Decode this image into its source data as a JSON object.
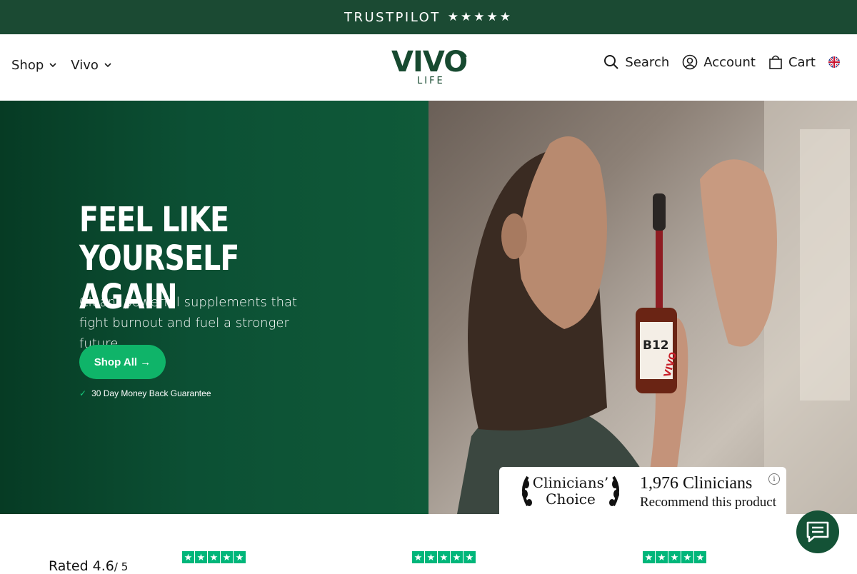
{
  "topbar": {
    "brand": "TRUSTPILOT",
    "stars": "★★★★★"
  },
  "nav": {
    "left": [
      {
        "label": "Shop"
      },
      {
        "label": "Vivo"
      }
    ],
    "logo": {
      "word": "VIVO",
      "sub": "LIFE"
    },
    "right": {
      "search": "Search",
      "account": "Account",
      "cart": "Cart",
      "region_icon": "uk-flag-icon"
    }
  },
  "hero": {
    "headline": "FEEL LIKE YOURSELF AGAIN",
    "subcopy": "Clean, powerful supplements that fight burnout and fuel a stronger future.",
    "cta": "Shop All →",
    "guarantee": "30 Day Money Back Guarantee",
    "bottle_label": "B12",
    "bottle_brand": "VIVO"
  },
  "badge": {
    "title_line1": "Clinicians’",
    "title_line2": "Choice",
    "count": "1,976 Clinicians",
    "recommend": "Recommend this product",
    "info": "i"
  },
  "reviews": {
    "rated": "Rated 4.6",
    "out_of": "/ 5",
    "star_glyph": "★"
  },
  "colors": {
    "topbar": "#1b4a33",
    "hero_green": "#0c5034",
    "cta": "#0fb469",
    "trustpilot": "#00b67a"
  }
}
